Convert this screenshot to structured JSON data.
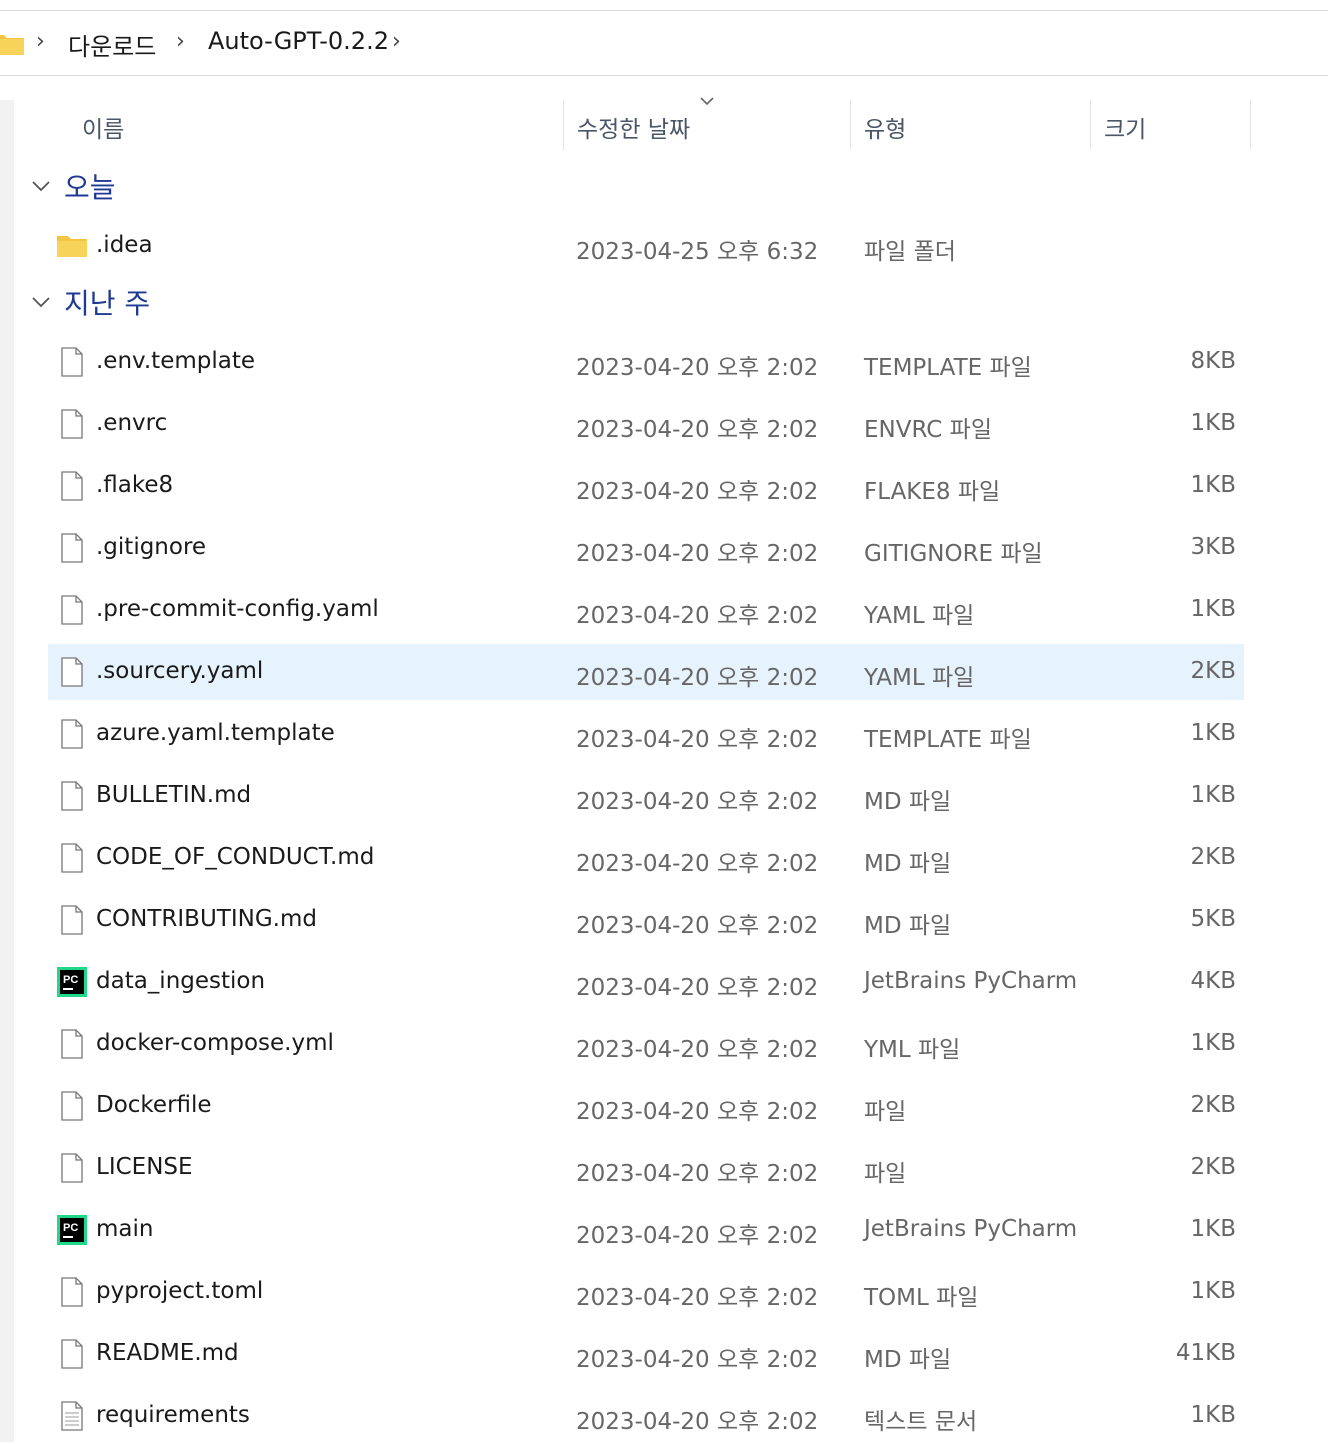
{
  "breadcrumb": {
    "items": [
      "다운로드",
      "Auto-GPT-0.2.2"
    ],
    "separator": "›"
  },
  "columns": {
    "name": "이름",
    "date": "수정한 날짜",
    "type": "유형",
    "size": "크기"
  },
  "groups": [
    {
      "label": "오늘",
      "rows": [
        {
          "name": ".idea",
          "date": "2023-04-25 오후 6:32",
          "type": "파일 폴더",
          "size": "",
          "icon": "folder-icon"
        }
      ]
    },
    {
      "label": "지난 주",
      "rows": [
        {
          "name": ".env.template",
          "date": "2023-04-20 오후 2:02",
          "type": "TEMPLATE 파일",
          "size": "8KB",
          "icon": "file-icon"
        },
        {
          "name": ".envrc",
          "date": "2023-04-20 오후 2:02",
          "type": "ENVRC 파일",
          "size": "1KB",
          "icon": "file-icon"
        },
        {
          "name": ".flake8",
          "date": "2023-04-20 오후 2:02",
          "type": "FLAKE8 파일",
          "size": "1KB",
          "icon": "file-icon"
        },
        {
          "name": ".gitignore",
          "date": "2023-04-20 오후 2:02",
          "type": "GITIGNORE 파일",
          "size": "3KB",
          "icon": "file-icon"
        },
        {
          "name": ".pre-commit-config.yaml",
          "date": "2023-04-20 오후 2:02",
          "type": "YAML 파일",
          "size": "1KB",
          "icon": "file-icon"
        },
        {
          "name": ".sourcery.yaml",
          "date": "2023-04-20 오후 2:02",
          "type": "YAML 파일",
          "size": "2KB",
          "icon": "file-icon",
          "selected": true
        },
        {
          "name": "azure.yaml.template",
          "date": "2023-04-20 오후 2:02",
          "type": "TEMPLATE 파일",
          "size": "1KB",
          "icon": "file-icon"
        },
        {
          "name": "BULLETIN.md",
          "date": "2023-04-20 오후 2:02",
          "type": "MD 파일",
          "size": "1KB",
          "icon": "file-icon"
        },
        {
          "name": "CODE_OF_CONDUCT.md",
          "date": "2023-04-20 오후 2:02",
          "type": "MD 파일",
          "size": "2KB",
          "icon": "file-icon"
        },
        {
          "name": "CONTRIBUTING.md",
          "date": "2023-04-20 오후 2:02",
          "type": "MD 파일",
          "size": "5KB",
          "icon": "file-icon"
        },
        {
          "name": "data_ingestion",
          "date": "2023-04-20 오후 2:02",
          "type": "JetBrains PyCharm",
          "size": "4KB",
          "icon": "pycharm-icon"
        },
        {
          "name": "docker-compose.yml",
          "date": "2023-04-20 오후 2:02",
          "type": "YML 파일",
          "size": "1KB",
          "icon": "file-icon"
        },
        {
          "name": "Dockerfile",
          "date": "2023-04-20 오후 2:02",
          "type": "파일",
          "size": "2KB",
          "icon": "file-icon"
        },
        {
          "name": "LICENSE",
          "date": "2023-04-20 오후 2:02",
          "type": "파일",
          "size": "2KB",
          "icon": "file-icon"
        },
        {
          "name": "main",
          "date": "2023-04-20 오후 2:02",
          "type": "JetBrains PyCharm",
          "size": "1KB",
          "icon": "pycharm-icon"
        },
        {
          "name": "pyproject.toml",
          "date": "2023-04-20 오후 2:02",
          "type": "TOML 파일",
          "size": "1KB",
          "icon": "file-icon"
        },
        {
          "name": "README.md",
          "date": "2023-04-20 오후 2:02",
          "type": "MD 파일",
          "size": "41KB",
          "icon": "file-icon"
        },
        {
          "name": "requirements",
          "date": "2023-04-20 오후 2:02",
          "type": "텍스트 문서",
          "size": "1KB",
          "icon": "text-file-icon"
        }
      ]
    }
  ],
  "colors": {
    "selection": "#e6f2fc",
    "group_label": "#1f3a93",
    "folder": "#f4c542",
    "pycharm_bg": "#000000",
    "pycharm_accent": "#21d789"
  }
}
